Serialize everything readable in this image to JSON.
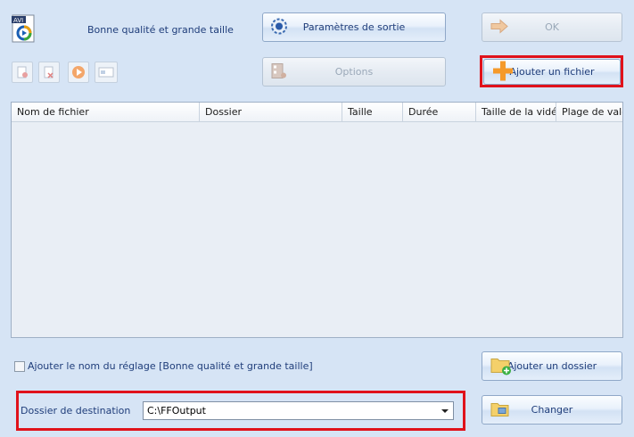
{
  "preset": {
    "icon": "avi-file-icon",
    "label": "Bonne qualité et grande taille",
    "icon_text": "AVI"
  },
  "toolbar": {
    "output_params_label": "Paramètres de sortie",
    "ok_label": "OK",
    "options_label": "Options",
    "add_file_label": "Ajouter un fichier",
    "tools": [
      "clear-list-icon",
      "remove-icon",
      "play-icon",
      "info-icon"
    ]
  },
  "file_list": {
    "columns": [
      "Nom de fichier",
      "Dossier",
      "Taille",
      "Durée",
      "Taille de la vidéo",
      "Plage de valeu"
    ],
    "rows": []
  },
  "append_preset_name": {
    "checked": false,
    "label": "Ajouter le nom du réglage [Bonne qualité et grande taille]"
  },
  "add_folder_label": "Ajouter un dossier",
  "destination": {
    "label": "Dossier de destination",
    "value": "C:\\FFOutput",
    "change_label": "Changer"
  },
  "colors": {
    "background": "#d6e4f5",
    "highlight": "#e0121b",
    "text": "#1f3d7a"
  }
}
